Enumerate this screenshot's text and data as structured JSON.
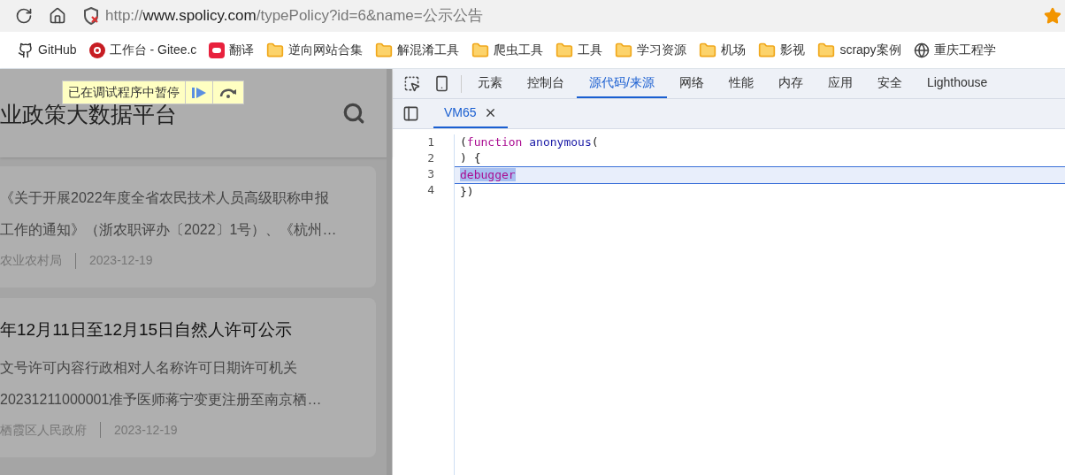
{
  "browser": {
    "url_prefix": "http://",
    "url_host": "www.spolicy.com",
    "url_path": "/typePolicy?id=6&name=公示公告",
    "bookmarked": true
  },
  "bookmarks": [
    {
      "kind": "github",
      "label": "GitHub"
    },
    {
      "kind": "gitee",
      "label": "工作台 - Gitee.c"
    },
    {
      "kind": "youdao",
      "label": "翻译"
    },
    {
      "kind": "folder",
      "label": "逆向网站合集"
    },
    {
      "kind": "folder",
      "label": "解混淆工具"
    },
    {
      "kind": "folder",
      "label": "爬虫工具"
    },
    {
      "kind": "folder",
      "label": "工具"
    },
    {
      "kind": "folder",
      "label": "学习资源"
    },
    {
      "kind": "folder",
      "label": "机场"
    },
    {
      "kind": "folder",
      "label": "影视"
    },
    {
      "kind": "folder",
      "label": "scrapy案例"
    },
    {
      "kind": "globe",
      "label": "重庆工程学"
    }
  ],
  "page": {
    "paused_label": "已在调试程序中暂停",
    "site_title": "业政策大数据平台",
    "cards": [
      {
        "lines": [
          "《关于开展2022年度全省农民技术人员高级职称申报",
          "工作的通知》（浙农职评办〔2022〕1号）、《杭州…"
        ],
        "source": "农业农村局",
        "date": "2023-12-19"
      },
      {
        "title": "年12月11日至12月15日自然人许可公示",
        "lines": [
          "文号许可内容行政相对人名称许可日期许可机关",
          "20231211000001准予医师蒋宁变更注册至南京栖…"
        ],
        "source": "栖霞区人民政府",
        "date": "2023-12-19"
      }
    ]
  },
  "devtools": {
    "tabs": [
      {
        "label": "元素",
        "selected": false
      },
      {
        "label": "控制台",
        "selected": false
      },
      {
        "label": "源代码/来源",
        "selected": true
      },
      {
        "label": "网络",
        "selected": false
      },
      {
        "label": "性能",
        "selected": false
      },
      {
        "label": "内存",
        "selected": false
      },
      {
        "label": "应用",
        "selected": false
      },
      {
        "label": "安全",
        "selected": false
      },
      {
        "label": "Lighthouse",
        "selected": false
      }
    ],
    "file_tab": "VM65",
    "lines": [
      {
        "number": "1",
        "current": false,
        "tokens": [
          {
            "kind": "plain",
            "text": "("
          },
          {
            "kind": "keyword",
            "text": "function "
          },
          {
            "kind": "name",
            "text": "anonymous"
          },
          {
            "kind": "plain",
            "text": "("
          }
        ]
      },
      {
        "number": "2",
        "current": false,
        "tokens": [
          {
            "kind": "plain",
            "text": ") {"
          }
        ]
      },
      {
        "number": "3",
        "current": true,
        "tokens": [
          {
            "kind": "selected-keyword",
            "text": "debugger"
          }
        ]
      },
      {
        "number": "4",
        "current": false,
        "tokens": [
          {
            "kind": "plain",
            "text": "})"
          }
        ]
      }
    ]
  }
}
